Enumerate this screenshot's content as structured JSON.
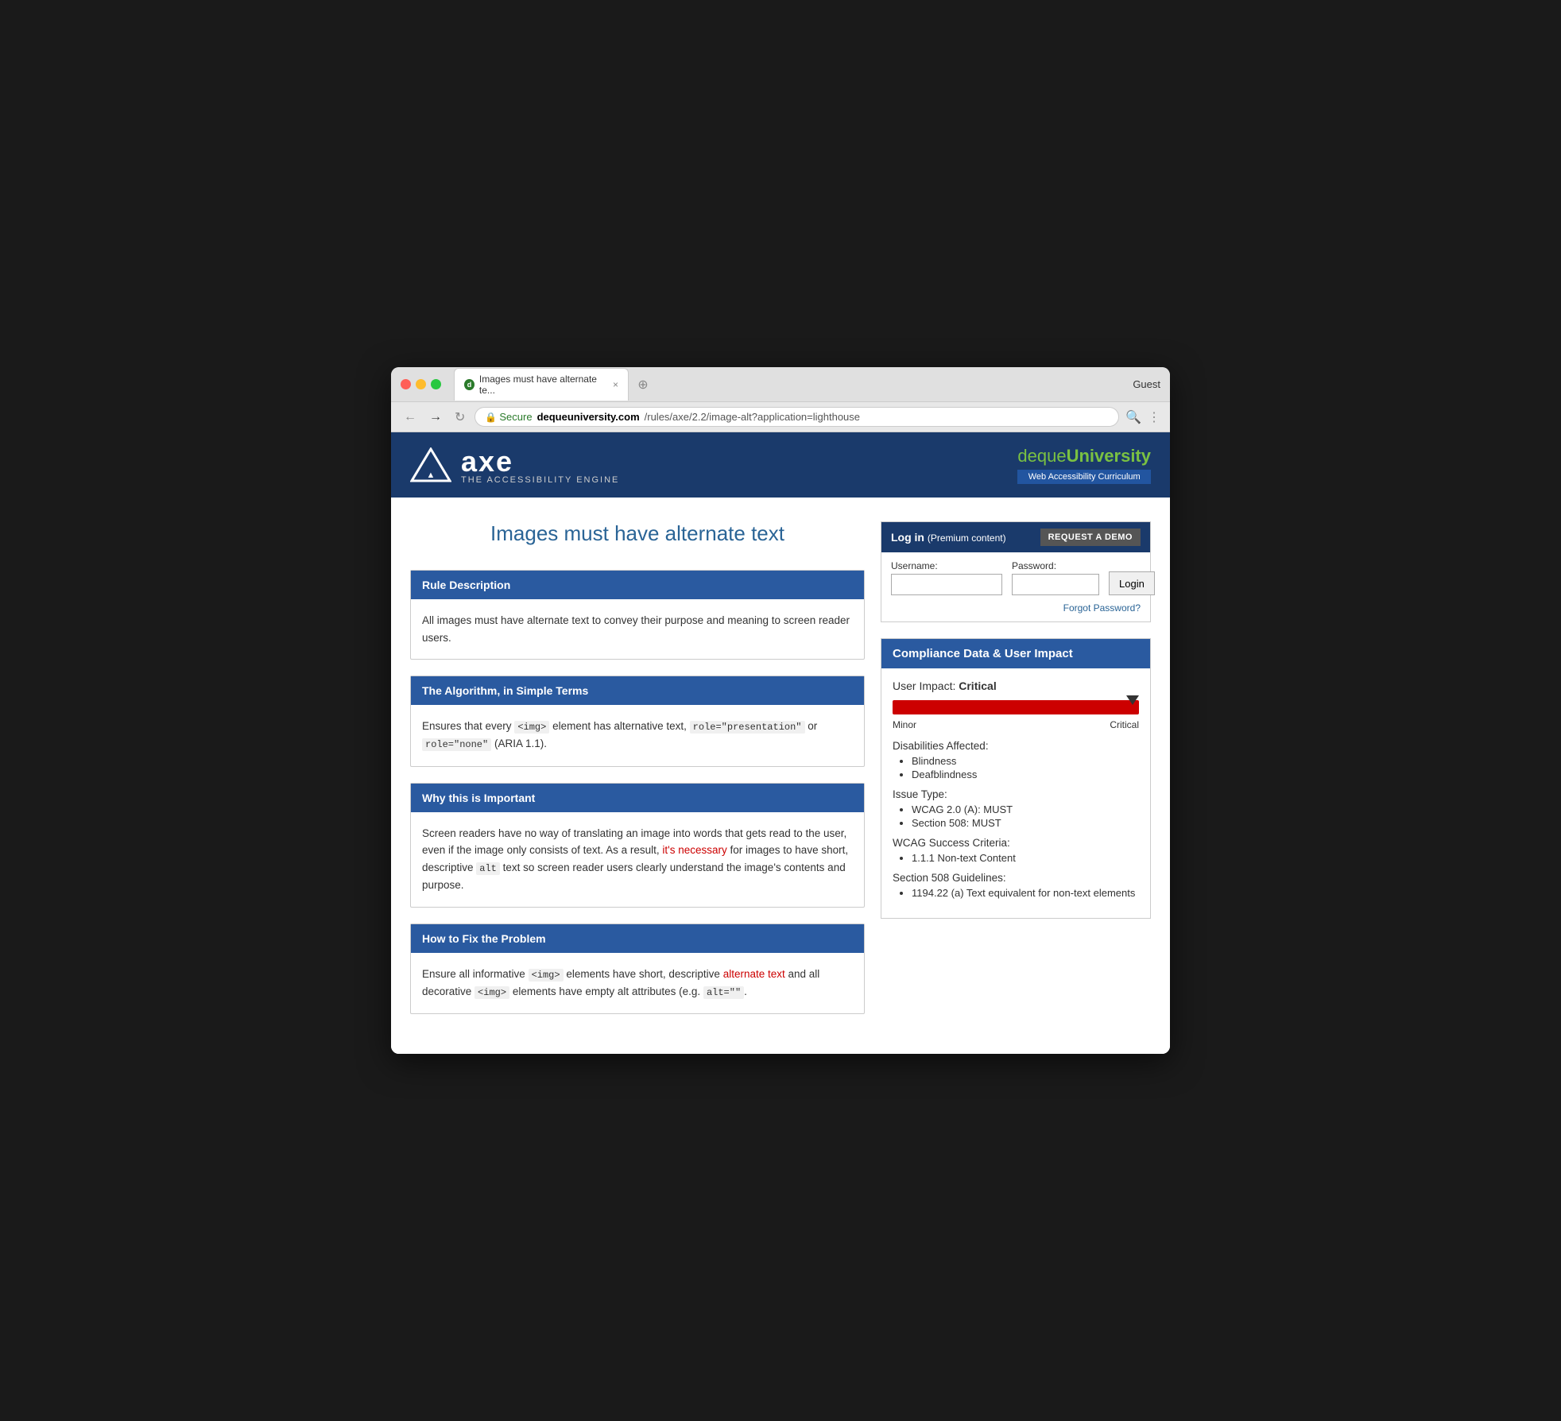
{
  "browser": {
    "tab_title": "Images must have alternate te...",
    "close_label": "×",
    "guest_label": "Guest",
    "secure_label": "Secure",
    "url": "https://dequeuniversity.com/rules/axe/2.2/image-alt?application=lighthouse",
    "url_domain": "dequeuniversity.com",
    "url_path": "/rules/axe/2.2/image-alt?application=lighthouse"
  },
  "header": {
    "axe_name": "axe",
    "axe_tagline": "THE ACCESSIBILITY ENGINE",
    "deque_name_prefix": "deque",
    "deque_name_suffix": "University",
    "deque_subtitle": "Web Accessibility Curriculum"
  },
  "login": {
    "header_text": "Log in",
    "premium_text": "(Premium content)",
    "request_demo_label": "REQUEST A DEMO",
    "username_label": "Username:",
    "password_label": "Password:",
    "login_btn_label": "Login",
    "forgot_password_label": "Forgot Password?"
  },
  "page": {
    "title": "Images must have alternate text"
  },
  "sections": [
    {
      "id": "rule-description",
      "header": "Rule Description",
      "body_html": "All images must have alternate text to convey their purpose and meaning to screen reader users."
    },
    {
      "id": "algorithm",
      "header": "The Algorithm, in Simple Terms",
      "body_html": "Ensures that every <code>&lt;img&gt;</code> element has alternative text, <code>role=\"presentation\"</code> or <code>role=\"none\"</code> (ARIA 1.1)."
    },
    {
      "id": "why-important",
      "header": "Why this is Important",
      "body_html": "Screen readers have no way of translating an image into words that gets read to the user, even if the image only consists of text. As a result, it's necessary for images to have short, descriptive <code>alt</code> text so screen reader users clearly understand the image's contents and purpose."
    },
    {
      "id": "how-to-fix",
      "header": "How to Fix the Problem",
      "body_html": "Ensure all informative <code>&lt;img&gt;</code> elements have short, descriptive alternate text and all decorative <code>&lt;img&gt;</code> elements have empty alt attributes (e.g. <code>alt=\"\"</code>."
    }
  ],
  "compliance": {
    "header": "Compliance Data & User Impact",
    "user_impact_label": "User Impact:",
    "user_impact_value": "Critical",
    "impact_min_label": "Minor",
    "impact_max_label": "Critical",
    "disabilities_label": "Disabilities Affected:",
    "disabilities": [
      "Blindness",
      "Deafblindness"
    ],
    "issue_type_label": "Issue Type:",
    "issue_types": [
      "WCAG 2.0 (A): MUST",
      "Section 508: MUST"
    ],
    "wcag_label": "WCAG Success Criteria:",
    "wcag_items": [
      "1.1.1 Non-text Content"
    ],
    "section_508_label": "Section 508 Guidelines:",
    "section_508_items": [
      "1194.22 (a) Text equivalent for non-text elements"
    ]
  }
}
